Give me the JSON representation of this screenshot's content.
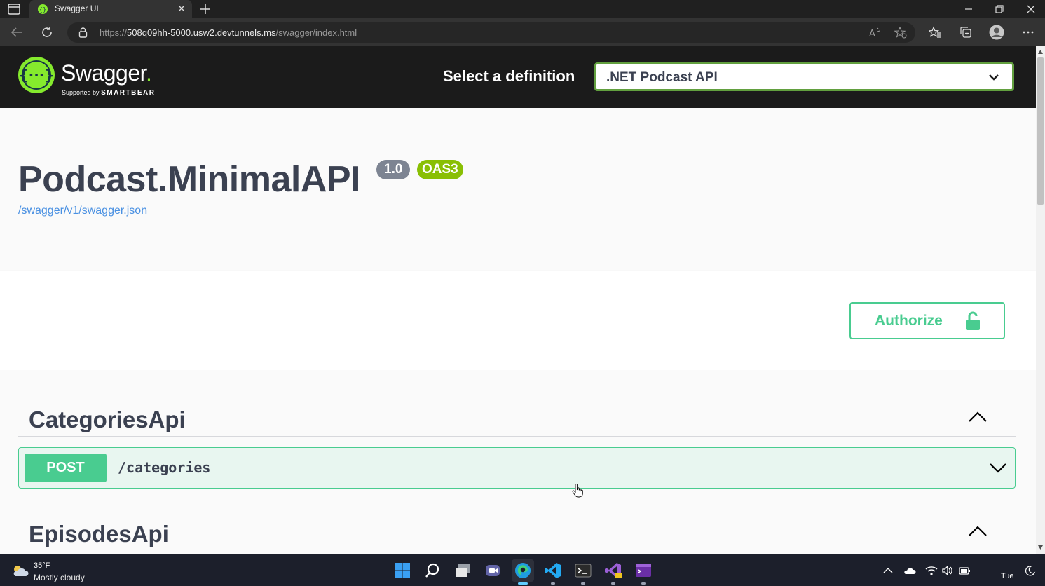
{
  "browser": {
    "tab_title": "Swagger UI",
    "url_prefix": "https://",
    "url_host": "508q09hh-5000.usw2.devtunnels.ms",
    "url_path": "/swagger/index.html"
  },
  "swagger": {
    "brand": "Swagger",
    "brand_dot": ".",
    "supported_by": "Supported by",
    "smartbear": "SMARTBEAR",
    "select_label": "Select a definition",
    "selected_definition": ".NET Podcast API"
  },
  "info": {
    "title": "Podcast.MinimalAPI",
    "version": "1.0",
    "oas": "OAS3",
    "spec_link": "/swagger/v1/swagger.json"
  },
  "authorize": {
    "label": "Authorize"
  },
  "tags": [
    {
      "name": "CategoriesApi",
      "operations": [
        {
          "method": "POST",
          "path": "/categories"
        }
      ]
    },
    {
      "name": "EpisodesApi"
    }
  ],
  "taskbar": {
    "weather_temp": "35°F",
    "weather_condition": "Mostly cloudy",
    "clock_day": "Tue"
  },
  "colors": {
    "swagger_green": "#85ea2d",
    "post_green": "#49cc90",
    "oas_badge": "#89bf04",
    "link_blue": "#4990e2",
    "text_dark": "#3b4151"
  }
}
